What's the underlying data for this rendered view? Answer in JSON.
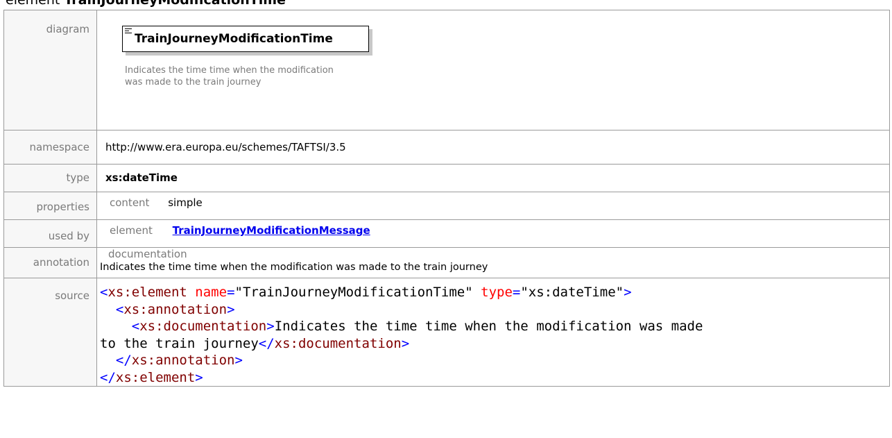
{
  "heading": {
    "prefix": "element",
    "name": "TrainJourneyModificationTime"
  },
  "labels": {
    "diagram": "diagram",
    "namespace": "namespace",
    "type": "type",
    "properties": "properties",
    "used_by": "used by",
    "annotation": "annotation",
    "source": "source"
  },
  "diagram": {
    "node_label": "TrainJourneyModificationTime",
    "documentation": "Indicates the time time when the modification was made to the train journey"
  },
  "namespace": "http://www.era.europa.eu/schemes/TAFTSI/3.5",
  "type": "xs:dateTime",
  "properties": {
    "key": "content",
    "value": "simple"
  },
  "used_by": {
    "kind": "element",
    "link": "TrainJourneyModificationMessage"
  },
  "annotation": {
    "label": "documentation",
    "text": "Indicates the time time when the modification was made to the train journey"
  },
  "source": {
    "el_open": "xs:element",
    "attr_name": "name",
    "attr_name_value": "\"TrainJourneyModificationTime\"",
    "attr_type": "type",
    "attr_type_value": "\"xs:dateTime\"",
    "annotation_tag": "xs:annotation",
    "documentation_tag": "xs:documentation",
    "doc_text_line1": "Indicates the time time when the modification was made",
    "doc_text_line2": "to the train journey"
  },
  "colors": {
    "tag": "#800000",
    "bracket": "#0000ff",
    "attribute": "#ff0000",
    "link": "#0000ee",
    "label_gray": "#7a7a7a"
  }
}
